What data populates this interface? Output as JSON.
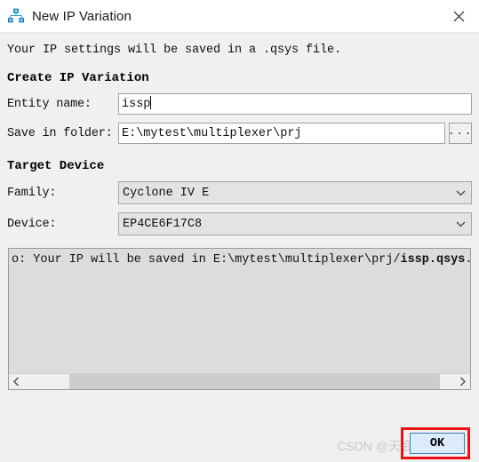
{
  "window": {
    "title": "New IP Variation",
    "icon": "hierarchy-icon",
    "close_label": "close-icon"
  },
  "intro": {
    "text": "Your IP settings will be saved in a .qsys file."
  },
  "sections": {
    "create": {
      "heading": "Create IP Variation",
      "entity": {
        "label": "Entity name:",
        "value": "issp",
        "placeholder": ""
      },
      "folder": {
        "label": "Save in folder:",
        "value": "E:\\mytest\\multiplexer\\prj",
        "placeholder": "",
        "browse_label": "..."
      }
    },
    "target": {
      "heading": "Target Device",
      "family": {
        "label": "Family:",
        "value": "Cyclone IV E"
      },
      "device": {
        "label": "Device:",
        "value": "EP4CE6F17C8"
      }
    }
  },
  "message_pane": {
    "line_prefix": "o: Your IP will be saved in E:\\mytest\\multiplexer\\prj/",
    "line_bold": "issp.qsys",
    "line_suffix": ".",
    "scroll_left_icon": "chevron-left-icon",
    "scroll_right_icon": "chevron-right-icon"
  },
  "footer": {
    "ok_label": "OK",
    "watermark": "CSDN @天会晴就会暗"
  },
  "colors": {
    "dialog_bg": "#f0f0f0",
    "titlebar_bg": "#ffffff",
    "input_bg": "#ffffff",
    "combo_bg": "#e3e3e3",
    "msgpane_bg": "#dcdcdc",
    "accent_button": "#dcebfb",
    "accent_border": "#3d7bb5",
    "highlight_red": "#ee1111",
    "icon_blue": "#1e8fd5"
  }
}
